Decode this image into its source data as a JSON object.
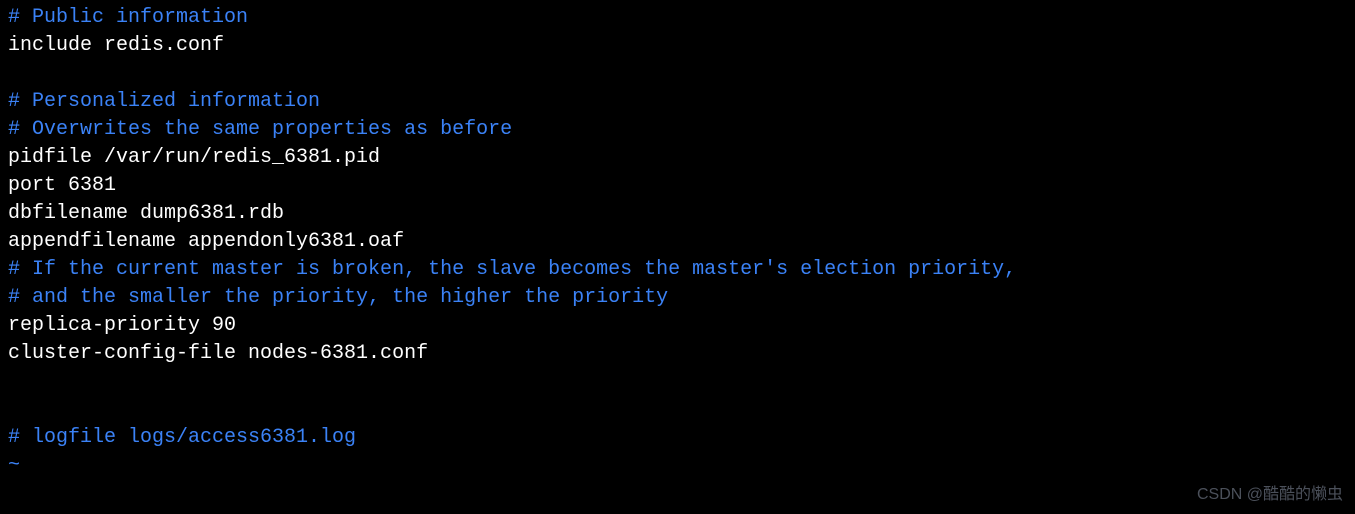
{
  "lines": [
    {
      "type": "comment",
      "text": "# Public information"
    },
    {
      "type": "directive",
      "text": "include redis.conf"
    },
    {
      "type": "blank",
      "text": ""
    },
    {
      "type": "comment",
      "text": "# Personalized information"
    },
    {
      "type": "comment",
      "text": "# Overwrites the same properties as before"
    },
    {
      "type": "directive",
      "text": "pidfile /var/run/redis_6381.pid"
    },
    {
      "type": "directive",
      "text": "port 6381"
    },
    {
      "type": "directive",
      "text": "dbfilename dump6381.rdb"
    },
    {
      "type": "directive",
      "text": "appendfilename appendonly6381.oaf"
    },
    {
      "type": "comment",
      "text": "# If the current master is broken, the slave becomes the master's election priority,"
    },
    {
      "type": "comment",
      "text": "# and the smaller the priority, the higher the priority"
    },
    {
      "type": "directive",
      "text": "replica-priority 90"
    },
    {
      "type": "directive",
      "text": "cluster-config-file nodes-6381.conf"
    },
    {
      "type": "blank",
      "text": ""
    },
    {
      "type": "blank",
      "text": ""
    },
    {
      "type": "comment",
      "text": "# logfile logs/access6381.log"
    },
    {
      "type": "tilde",
      "text": "~"
    }
  ],
  "watermark": "CSDN @酷酷的懒虫"
}
